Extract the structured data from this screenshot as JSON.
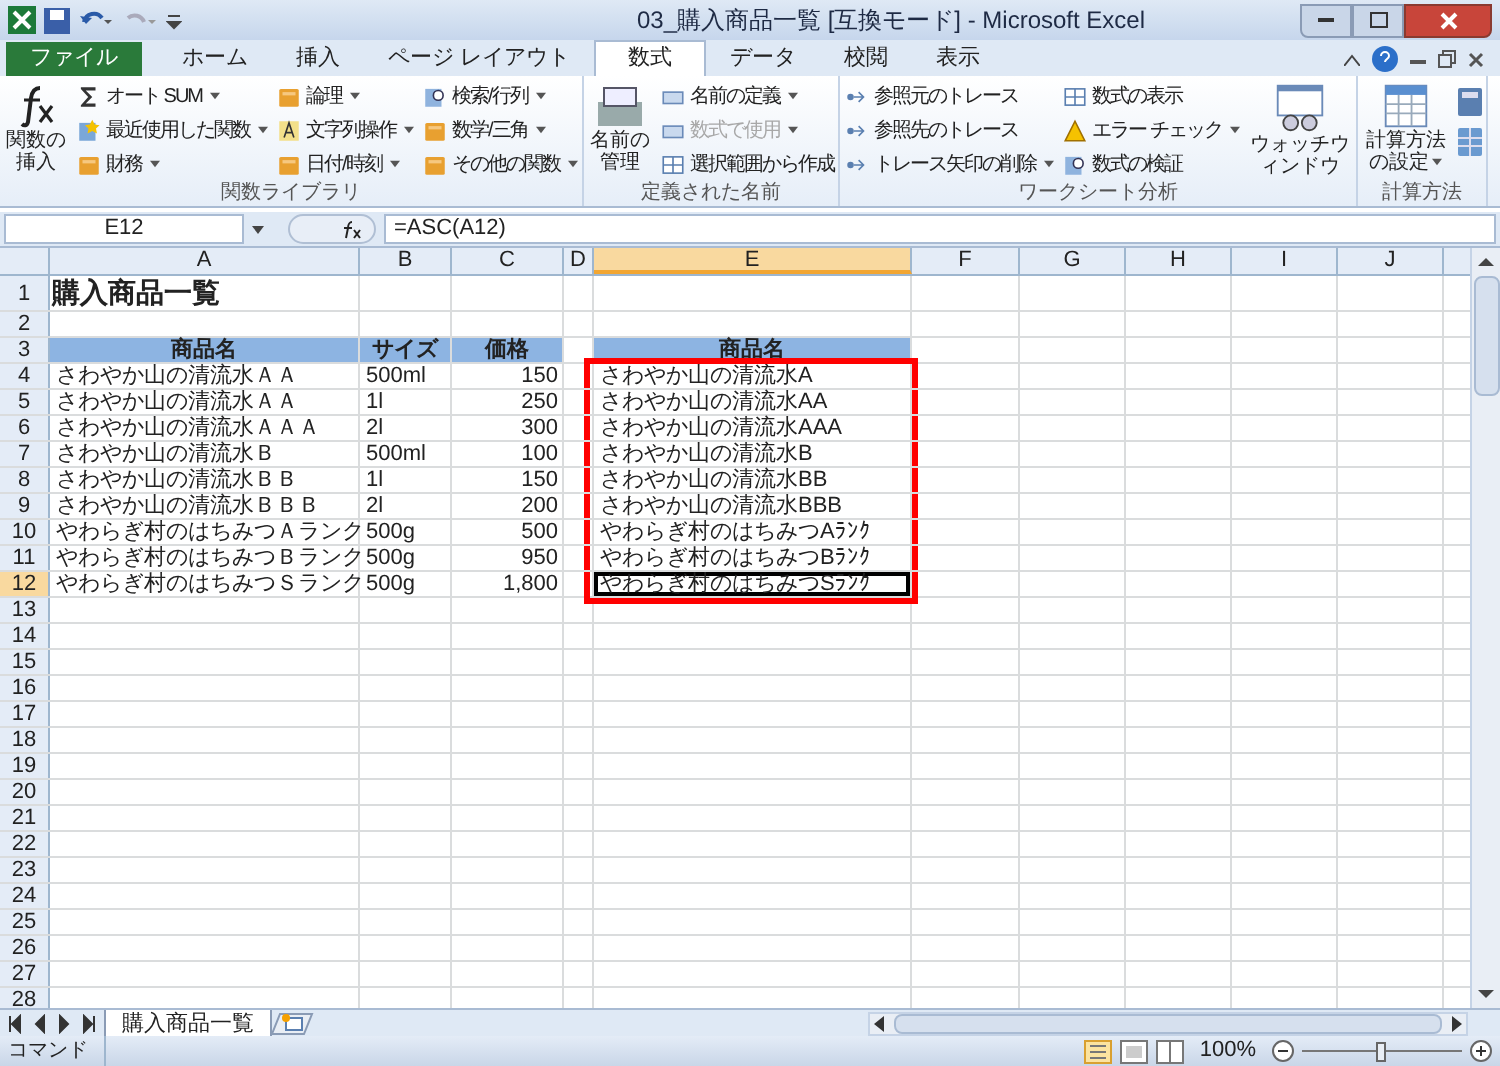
{
  "window": {
    "title": "03_購入商品一覧 [互換モード] - Microsoft Excel"
  },
  "tabs": [
    {
      "label": "ファイル",
      "kind": "file",
      "selected": false
    },
    {
      "label": "ホーム",
      "kind": "tab",
      "selected": false
    },
    {
      "label": "挿入",
      "kind": "tab",
      "selected": false
    },
    {
      "label": "ページ レイアウト",
      "kind": "tab",
      "selected": false
    },
    {
      "label": "数式",
      "kind": "tab",
      "selected": true
    },
    {
      "label": "データ",
      "kind": "tab",
      "selected": false
    },
    {
      "label": "校閲",
      "kind": "tab",
      "selected": false
    },
    {
      "label": "表示",
      "kind": "tab",
      "selected": false
    }
  ],
  "ribbon": [
    {
      "label": "関数ライブラリ",
      "items": [
        {
          "kind": "large",
          "label": "関数の挿入",
          "dropdown": false
        },
        {
          "kind": "stack",
          "items": [
            {
              "label": "オート SUM",
              "dropdown": true,
              "disabled": false
            },
            {
              "label": "最近使用した関数",
              "dropdown": true,
              "disabled": false
            },
            {
              "label": "財務",
              "dropdown": true,
              "disabled": false
            }
          ]
        },
        {
          "kind": "stack",
          "items": [
            {
              "label": "論理",
              "dropdown": true,
              "disabled": false
            },
            {
              "label": "文字列操作",
              "dropdown": true,
              "disabled": false
            },
            {
              "label": "日付/時刻",
              "dropdown": true,
              "disabled": false
            }
          ]
        },
        {
          "kind": "stack",
          "items": [
            {
              "label": "検索/行列",
              "dropdown": true,
              "disabled": false
            },
            {
              "label": "数学/三角",
              "dropdown": true,
              "disabled": false
            },
            {
              "label": "その他の関数",
              "dropdown": true,
              "disabled": false
            }
          ]
        }
      ]
    },
    {
      "label": "定義された名前",
      "items": [
        {
          "kind": "large",
          "label": "名前の管理",
          "dropdown": false
        },
        {
          "kind": "stack",
          "items": [
            {
              "label": "名前の定義",
              "dropdown": true,
              "disabled": false
            },
            {
              "label": "数式で使用",
              "dropdown": true,
              "disabled": true
            },
            {
              "label": "選択範囲から作成",
              "dropdown": false,
              "disabled": false
            }
          ]
        }
      ]
    },
    {
      "label": "ワークシート分析",
      "items": [
        {
          "kind": "stack",
          "items": [
            {
              "label": "参照元のトレース",
              "dropdown": false,
              "disabled": false
            },
            {
              "label": "参照先のトレース",
              "dropdown": false,
              "disabled": false
            },
            {
              "label": "トレース矢印の削除",
              "dropdown": true,
              "disabled": false
            }
          ]
        },
        {
          "kind": "stack",
          "items": [
            {
              "label": "数式の表示",
              "dropdown": false,
              "disabled": false
            },
            {
              "label": "エラー チェック",
              "dropdown": true,
              "disabled": false
            },
            {
              "label": "数式の検証",
              "dropdown": false,
              "disabled": false
            }
          ]
        },
        {
          "kind": "large",
          "label": "ウォッチウィンドウ",
          "dropdown": false
        }
      ]
    },
    {
      "label": "計算方法",
      "items": [
        {
          "kind": "large",
          "label": "計算方法の設定",
          "dropdown": true
        },
        {
          "kind": "icons"
        }
      ]
    }
  ],
  "formula_bar": {
    "name_box": "E12",
    "formula": "=ASC(A12)"
  },
  "columns": [
    {
      "label": "A",
      "selected": false
    },
    {
      "label": "B",
      "selected": false
    },
    {
      "label": "C",
      "selected": false
    },
    {
      "label": "D",
      "selected": false
    },
    {
      "label": "E",
      "selected": true
    },
    {
      "label": "F",
      "selected": false
    },
    {
      "label": "G",
      "selected": false
    },
    {
      "label": "H",
      "selected": false
    },
    {
      "label": "I",
      "selected": false
    },
    {
      "label": "J",
      "selected": false
    }
  ],
  "rows": [
    {
      "number": "1",
      "selected": false,
      "marked": false,
      "kind": "title",
      "cells": {
        "A": "購入商品一覧"
      }
    },
    {
      "number": "2",
      "selected": false,
      "marked": false
    },
    {
      "number": "3",
      "selected": false,
      "marked": false,
      "kind": "header",
      "cells": {
        "A": "商品名",
        "B": "サイズ",
        "C": "価格",
        "E": "商品名"
      }
    },
    {
      "number": "4",
      "selected": false,
      "marked": true,
      "kind": "data",
      "cells": {
        "A": "さわやか山の清流水ＡＡ",
        "B": "500ml",
        "C": "150",
        "E": "さわやか山の清流水A"
      }
    },
    {
      "number": "5",
      "selected": false,
      "marked": true,
      "kind": "data",
      "cells": {
        "A": "さわやか山の清流水ＡＡ",
        "B": "1l",
        "C": "250",
        "E": "さわやか山の清流水AA"
      }
    },
    {
      "number": "6",
      "selected": false,
      "marked": true,
      "kind": "data",
      "cells": {
        "A": "さわやか山の清流水ＡＡＡ",
        "B": "2l",
        "C": "300",
        "E": "さわやか山の清流水AAA"
      }
    },
    {
      "number": "7",
      "selected": false,
      "marked": true,
      "kind": "data",
      "cells": {
        "A": "さわやか山の清流水Ｂ",
        "B": "500ml",
        "C": "100",
        "E": "さわやか山の清流水B"
      }
    },
    {
      "number": "8",
      "selected": false,
      "marked": true,
      "kind": "data",
      "cells": {
        "A": "さわやか山の清流水ＢＢ",
        "B": "1l",
        "C": "150",
        "E": "さわやか山の清流水BB"
      }
    },
    {
      "number": "9",
      "selected": false,
      "marked": true,
      "kind": "data",
      "cells": {
        "A": "さわやか山の清流水ＢＢＢ",
        "B": "2l",
        "C": "200",
        "E": "さわやか山の清流水BBB"
      }
    },
    {
      "number": "10",
      "selected": false,
      "marked": true,
      "kind": "data",
      "cells": {
        "A": "やわらぎ村のはちみつＡランク",
        "B": "500g",
        "C": "500",
        "E": "やわらぎ村のはちみつAﾗﾝｸ"
      }
    },
    {
      "number": "11",
      "selected": false,
      "marked": true,
      "kind": "data",
      "cells": {
        "A": "やわらぎ村のはちみつＢランク",
        "B": "500g",
        "C": "950",
        "E": "やわらぎ村のはちみつBﾗﾝｸ"
      }
    },
    {
      "number": "12",
      "selected": true,
      "marked": true,
      "kind": "data",
      "cells": {
        "A": "やわらぎ村のはちみつＳランク",
        "B": "500g",
        "C": "1,800",
        "E": "やわらぎ村のはちみつSﾗﾝｸ"
      }
    },
    {
      "number": "13",
      "selected": false,
      "marked": false
    },
    {
      "number": "14",
      "selected": false,
      "marked": false
    },
    {
      "number": "15",
      "selected": false,
      "marked": false
    },
    {
      "number": "16",
      "selected": false,
      "marked": false
    },
    {
      "number": "17",
      "selected": false,
      "marked": false
    },
    {
      "number": "18",
      "selected": false,
      "marked": false
    },
    {
      "number": "19",
      "selected": false,
      "marked": false
    },
    {
      "number": "20",
      "selected": false,
      "marked": false
    },
    {
      "number": "21",
      "selected": false,
      "marked": false
    },
    {
      "number": "22",
      "selected": false,
      "marked": false
    },
    {
      "number": "23",
      "selected": false,
      "marked": false
    },
    {
      "number": "24",
      "selected": false,
      "marked": false
    },
    {
      "number": "25",
      "selected": false,
      "marked": false
    },
    {
      "number": "26",
      "selected": false,
      "marked": false
    },
    {
      "number": "27",
      "selected": false,
      "marked": false
    },
    {
      "number": "28",
      "selected": false,
      "marked": false
    }
  ],
  "sheet_tabs": [
    {
      "label": "購入商品一覧",
      "selected": true
    }
  ],
  "status_bar": {
    "mode": "コマンド",
    "zoom": "100%",
    "zoom_slider": {
      "level": 0.5
    }
  }
}
